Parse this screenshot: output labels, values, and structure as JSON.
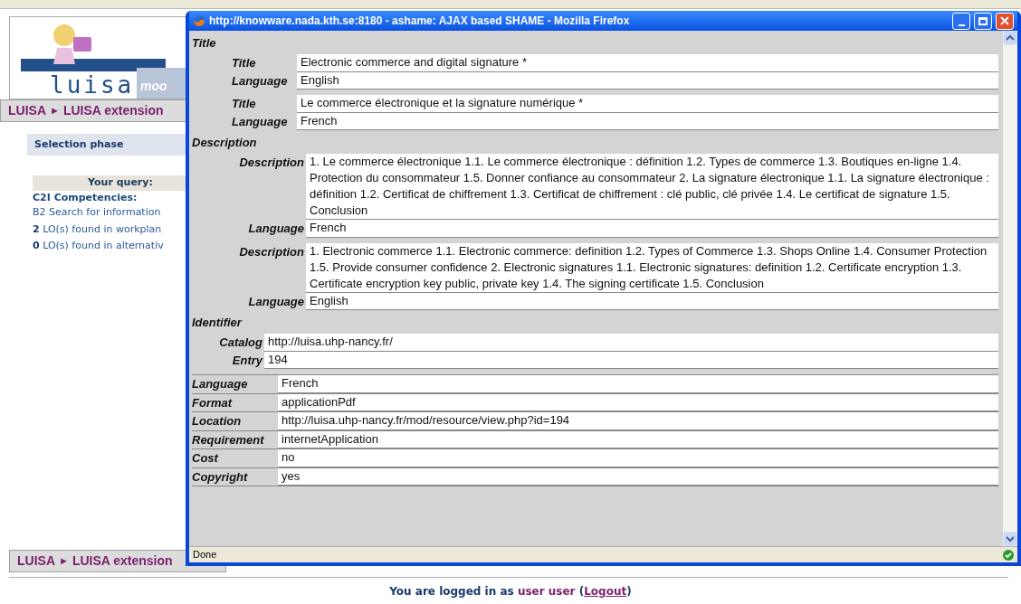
{
  "page": {
    "logo_text": "luisa",
    "logo_subtext": "moo",
    "breadcrumb": [
      "LUISA",
      "►",
      "LUISA extension"
    ],
    "phase": "Selection phase",
    "query_heading": "Your query:",
    "query_label": "C2I Competencies:",
    "query_value": "B2 Search for information",
    "results": [
      {
        "count": "2",
        "text": "LO(s) found in workplan"
      },
      {
        "count": "0",
        "text": "LO(s) found in alternativ"
      }
    ],
    "footer_breadcrumb": [
      "LUISA",
      "►",
      "LUISA extension"
    ],
    "login": {
      "before": "You are logged in as",
      "user": "user user",
      "paren_open": "(",
      "logout": "Logout",
      "paren_close": ")"
    }
  },
  "window": {
    "title": "http://knowware.nada.kth.se:8180 - ashame: AJAX based SHAME - Mozilla Firefox",
    "sections": [
      {
        "kind": "short",
        "heading": "Title",
        "entries": [
          {
            "rows": [
              {
                "label": "Title",
                "value": "Electronic commerce and digital signature *"
              },
              {
                "label": "Language",
                "value": "English"
              }
            ]
          },
          {
            "rows": [
              {
                "label": "Title",
                "value": "Le commerce électronique et la signature numérique *"
              },
              {
                "label": "Language",
                "value": "French"
              }
            ]
          }
        ]
      },
      {
        "kind": "long",
        "heading": "Description",
        "entries": [
          {
            "rows": [
              {
                "label": "Description",
                "value": "1. Le commerce électronique 1.1. Le commerce électronique : définition 1.2. Types de commerce 1.3. Boutiques en-ligne 1.4. Protection du consommateur 1.5. Donner confiance au consommateur 2. La signature électronique 1.1. La signature électronique : définition 1.2. Certificat de chiffrement 1.3. Certificat de chiffrement : clé public, clé privée 1.4. Le certificat de signature 1.5. Conclusion"
              },
              {
                "label": "Language",
                "value": "French"
              }
            ]
          },
          {
            "rows": [
              {
                "label": "Description",
                "value": "1. Electronic commerce 1.1. Electronic commerce: definition 1.2. Types of Commerce 1.3. Shops Online 1.4. Consumer Protection 1.5. Provide consumer confidence 2. Electronic signatures 1.1. Electronic signatures: definition 1.2. Certificate encryption 1.3. Certificate encryption key public, private key 1.4. The signing certificate 1.5. Conclusion"
              },
              {
                "label": "Language",
                "value": "English"
              }
            ]
          }
        ]
      },
      {
        "kind": "compact",
        "heading": "Identifier",
        "entries": [
          {
            "rows": [
              {
                "label": "Catalog",
                "value": "http://luisa.uhp-nancy.fr/"
              },
              {
                "label": "Entry",
                "value": "194"
              }
            ]
          }
        ]
      },
      {
        "kind": "flat",
        "rows": [
          {
            "label": "Language",
            "value": "French"
          },
          {
            "label": "Format",
            "value": "applicationPdf"
          },
          {
            "label": "Location",
            "value": "http://luisa.uhp-nancy.fr/mod/resource/view.php?id=194"
          },
          {
            "label": "Requirement",
            "value": "internetApplication"
          },
          {
            "label": "Cost",
            "value": "no"
          },
          {
            "label": "Copyright",
            "value": "yes"
          }
        ]
      }
    ],
    "status": "Done"
  }
}
